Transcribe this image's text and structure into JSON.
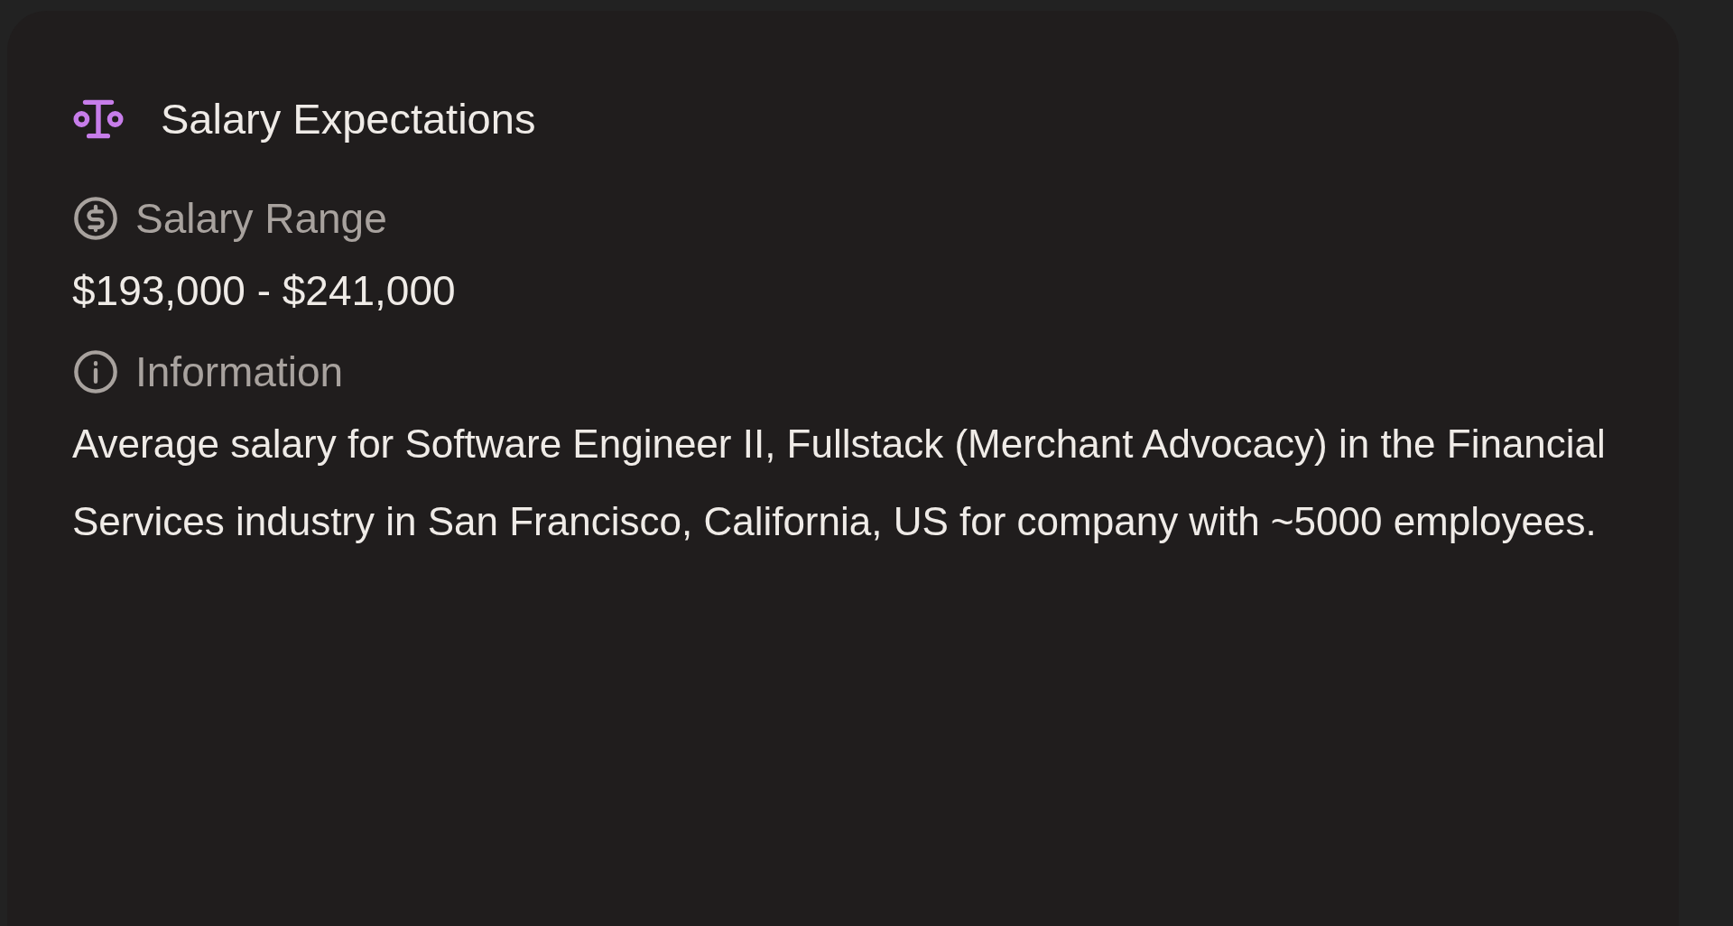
{
  "card": {
    "title": "Salary Expectations",
    "sections": [
      {
        "kind": "salary",
        "label": "Salary Range",
        "value": "$193,000 - $241,000"
      },
      {
        "kind": "info",
        "label": "Information",
        "value": "Average salary for Software Engineer II, Fullstack (Merchant Advocacy) in the Financial Services industry in San Francisco, California, US for company with ~5000 employees."
      }
    ]
  }
}
